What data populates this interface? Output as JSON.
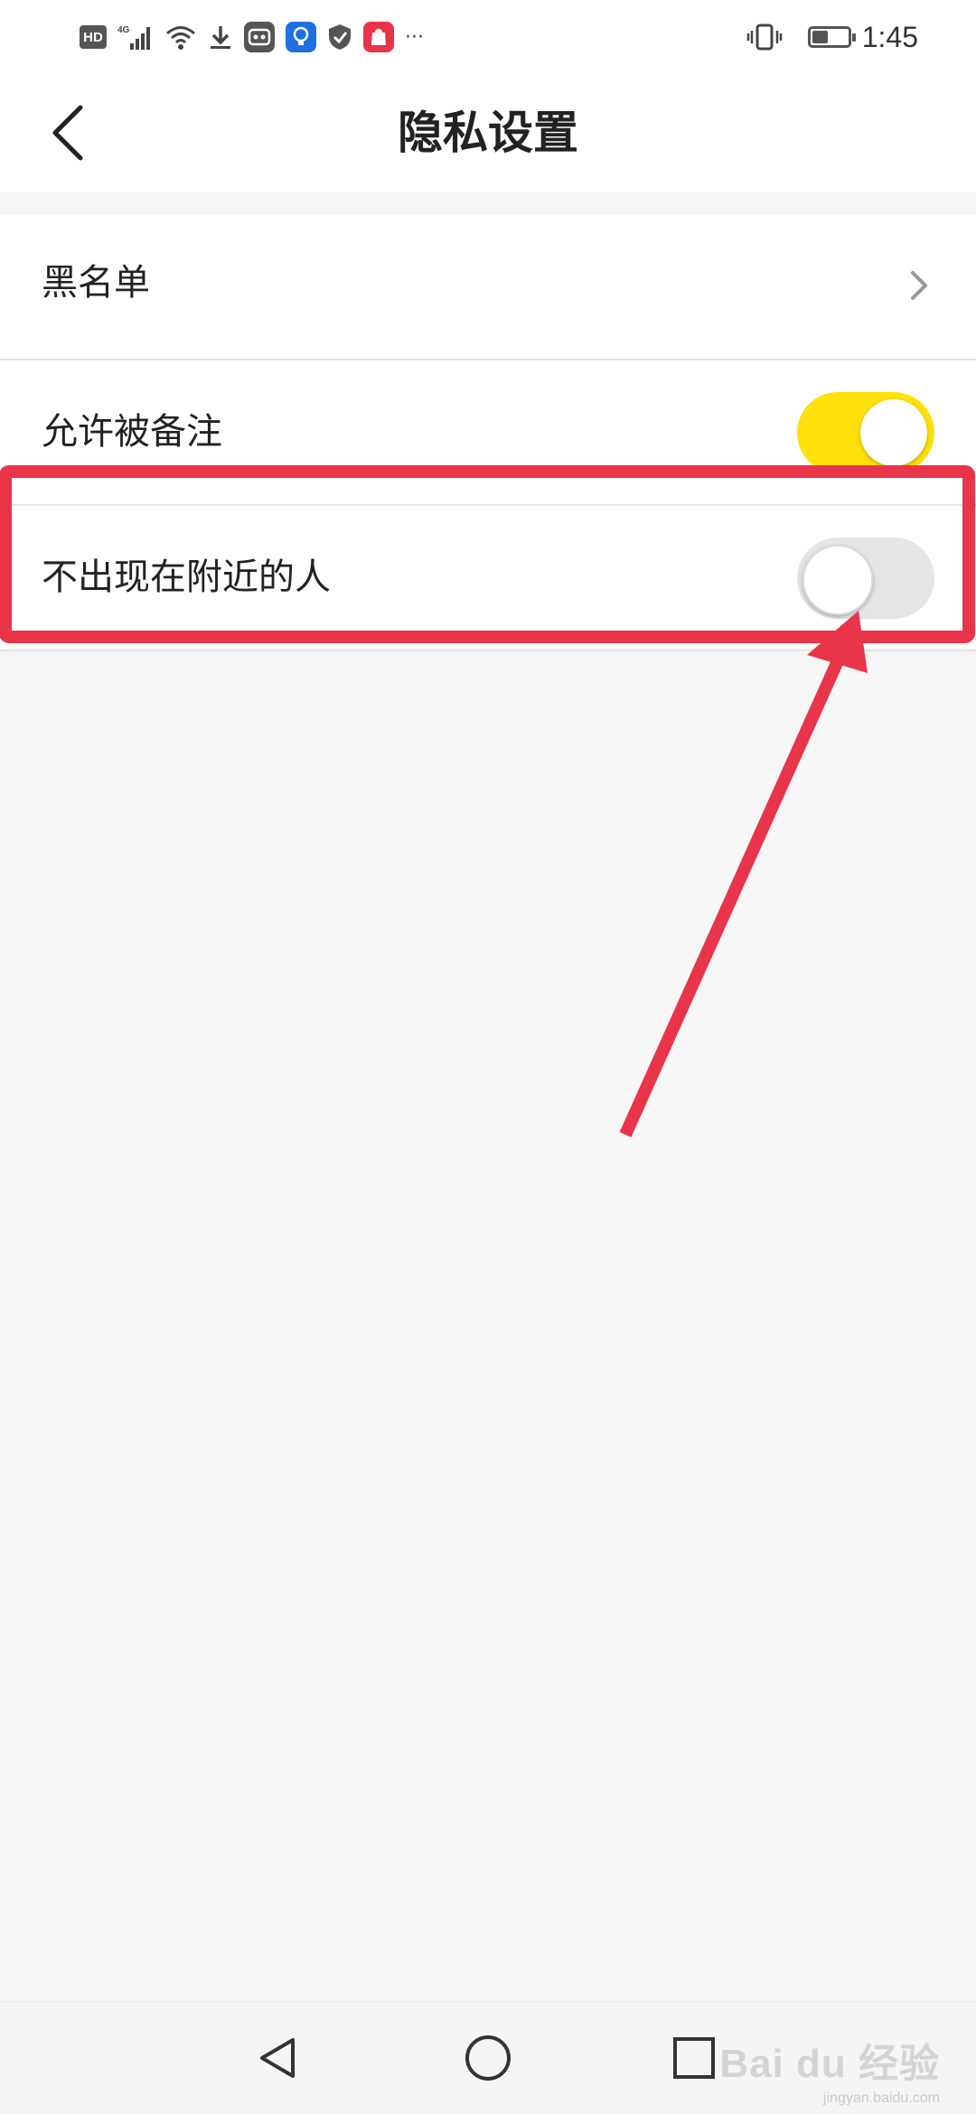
{
  "status_bar": {
    "hd_label": "HD",
    "network_label": "4G",
    "more": "···",
    "time": "1:45",
    "battery_level": 0.45,
    "app_icons": [
      "hd-icon",
      "signal-icon",
      "wifi-icon",
      "download-icon",
      "robot-app-icon",
      "bulb-app-icon",
      "shield-icon",
      "huawei-app-icon",
      "vibrate-icon",
      "battery-icon"
    ]
  },
  "header": {
    "title": "隐私设置",
    "back_icon": "chevron-left-icon"
  },
  "settings": {
    "items": [
      {
        "label": "黑名单",
        "control": "chevron"
      },
      {
        "label": "允许被备注",
        "control": "toggle",
        "on": true
      },
      {
        "label": "不出现在附近的人",
        "control": "toggle",
        "on": false
      }
    ]
  },
  "annotation": {
    "highlight_color": "#e8354a",
    "arrow_color": "#e8354a"
  },
  "colors": {
    "toggle_on": "#fee10b",
    "toggle_off": "#e5e5e5",
    "background": "#f7f7f7"
  },
  "nav_bar": {
    "icons": [
      "back-triangle-icon",
      "home-circle-icon",
      "recents-square-icon"
    ]
  },
  "watermark": {
    "text": "Bai du 经验",
    "sub": "jingyan.baidu.com"
  }
}
